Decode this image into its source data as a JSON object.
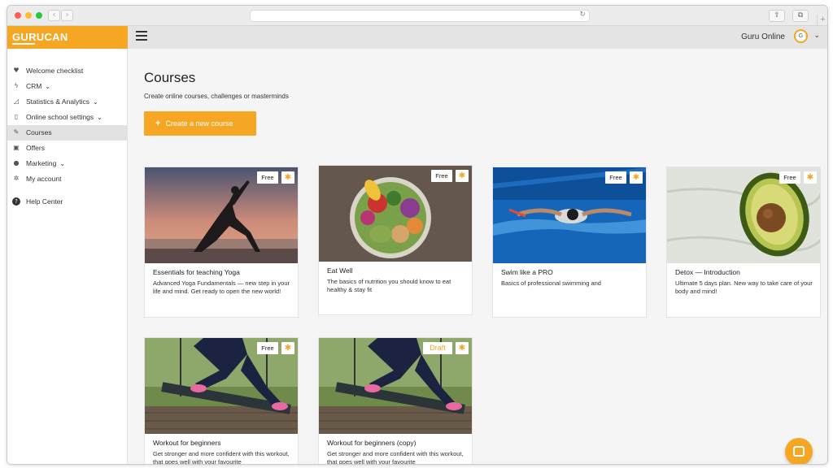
{
  "browser": {
    "back": "‹",
    "forward": "›",
    "reload": "↻",
    "share": "⇪",
    "tabs": "⧉",
    "new_tab": "+"
  },
  "header": {
    "logo_text": "GURUCAN",
    "user_name": "Guru Online",
    "user_badge": "G",
    "chevron": "⌄"
  },
  "sidebar": {
    "items": [
      {
        "icon": "heart-icon",
        "glyph": "♥",
        "label": "Welcome checklist",
        "has_chevron": false
      },
      {
        "icon": "bolt-icon",
        "glyph": "ϟ",
        "label": "CRM",
        "has_chevron": true
      },
      {
        "icon": "chart-icon",
        "glyph": "◿",
        "label": "Statistics & Analytics",
        "has_chevron": true
      },
      {
        "icon": "mobile-icon",
        "glyph": "▯",
        "label": "Online school settings",
        "has_chevron": true
      },
      {
        "icon": "pencil-icon",
        "glyph": "✎",
        "label": "Courses",
        "has_chevron": false,
        "active": true
      },
      {
        "icon": "ticket-icon",
        "glyph": "▣",
        "label": "Offers",
        "has_chevron": false
      },
      {
        "icon": "chat-icon",
        "glyph": "●",
        "label": "Marketing",
        "has_chevron": true
      },
      {
        "icon": "gear-icon",
        "glyph": "✲",
        "label": "My account",
        "has_chevron": false
      },
      {
        "icon": "help-icon",
        "glyph": "?",
        "label": "Help Center",
        "has_chevron": false
      }
    ],
    "chevron": "⌄"
  },
  "main": {
    "title": "Courses",
    "subtitle": "Create online courses, challenges or masterminds",
    "create_button": {
      "plus": "+",
      "label": "Create a new course"
    }
  },
  "courses": [
    {
      "title": "Essentials for teaching Yoga",
      "description": "Advanced Yoga Fundamentals — new step in your life and mind. Get ready to open the new world!",
      "status": "Free",
      "image": "yoga-sunset"
    },
    {
      "title": "Eat Well",
      "description": "The basics of nutrition you should know to eat healthy & stay fit",
      "status": "Free",
      "image": "salad-bowl"
    },
    {
      "title": "Swim like a PRO",
      "description": "Basics of professional swimming and",
      "status": "Free",
      "image": "swimmer"
    },
    {
      "title": "Detox — Introduction",
      "description": "Ultimate 5 days plan. New way to take care of your body and mind!",
      "status": "Free",
      "image": "avocado"
    },
    {
      "title": "Workout for beginners",
      "description": "Get stronger and more confident with this workout, that goes well with your favourite",
      "status": "Free",
      "image": "workout-swing"
    },
    {
      "title": "Workout for beginners (copy)",
      "description": "Get stronger and more confident with this workout, that goes well with your favourite",
      "status": "Draft",
      "image": "workout-swing"
    }
  ],
  "gear_glyph": "✱",
  "colors": {
    "accent": "#f5a623",
    "header_bg": "#e4e4e4",
    "sidebar_active": "#e2e2e2",
    "page_bg": "#f5f5f5"
  }
}
